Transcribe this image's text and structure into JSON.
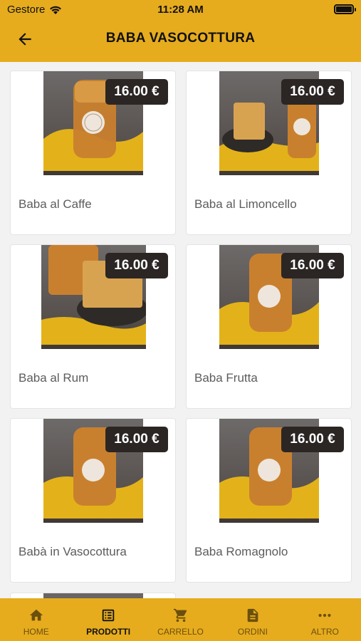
{
  "status": {
    "carrier": "Gestore",
    "time": "11:28 AM"
  },
  "header": {
    "title": "BABA VASOCOTTURA",
    "back_icon": "arrow-left-icon"
  },
  "products": [
    {
      "name": "Baba al Caffe",
      "price": "16.00 €"
    },
    {
      "name": "Baba al Limoncello",
      "price": "16.00 €"
    },
    {
      "name": "Baba al Rum",
      "price": "16.00 €"
    },
    {
      "name": "Baba Frutta",
      "price": "16.00 €"
    },
    {
      "name": "Babà in Vasocottura",
      "price": "16.00 €"
    },
    {
      "name": "Baba Romagnolo",
      "price": "16.00 €"
    }
  ],
  "nav": [
    {
      "label": "HOME",
      "icon": "home-icon",
      "active": false
    },
    {
      "label": "PRODOTTI",
      "icon": "list-icon",
      "active": true
    },
    {
      "label": "CARRELLO",
      "icon": "cart-icon",
      "active": false
    },
    {
      "label": "ORDINI",
      "icon": "document-icon",
      "active": false
    },
    {
      "label": "ALTRO",
      "icon": "more-icon",
      "active": false
    }
  ],
  "colors": {
    "accent": "#e6ac1e",
    "price_badge": "#2b2624"
  }
}
